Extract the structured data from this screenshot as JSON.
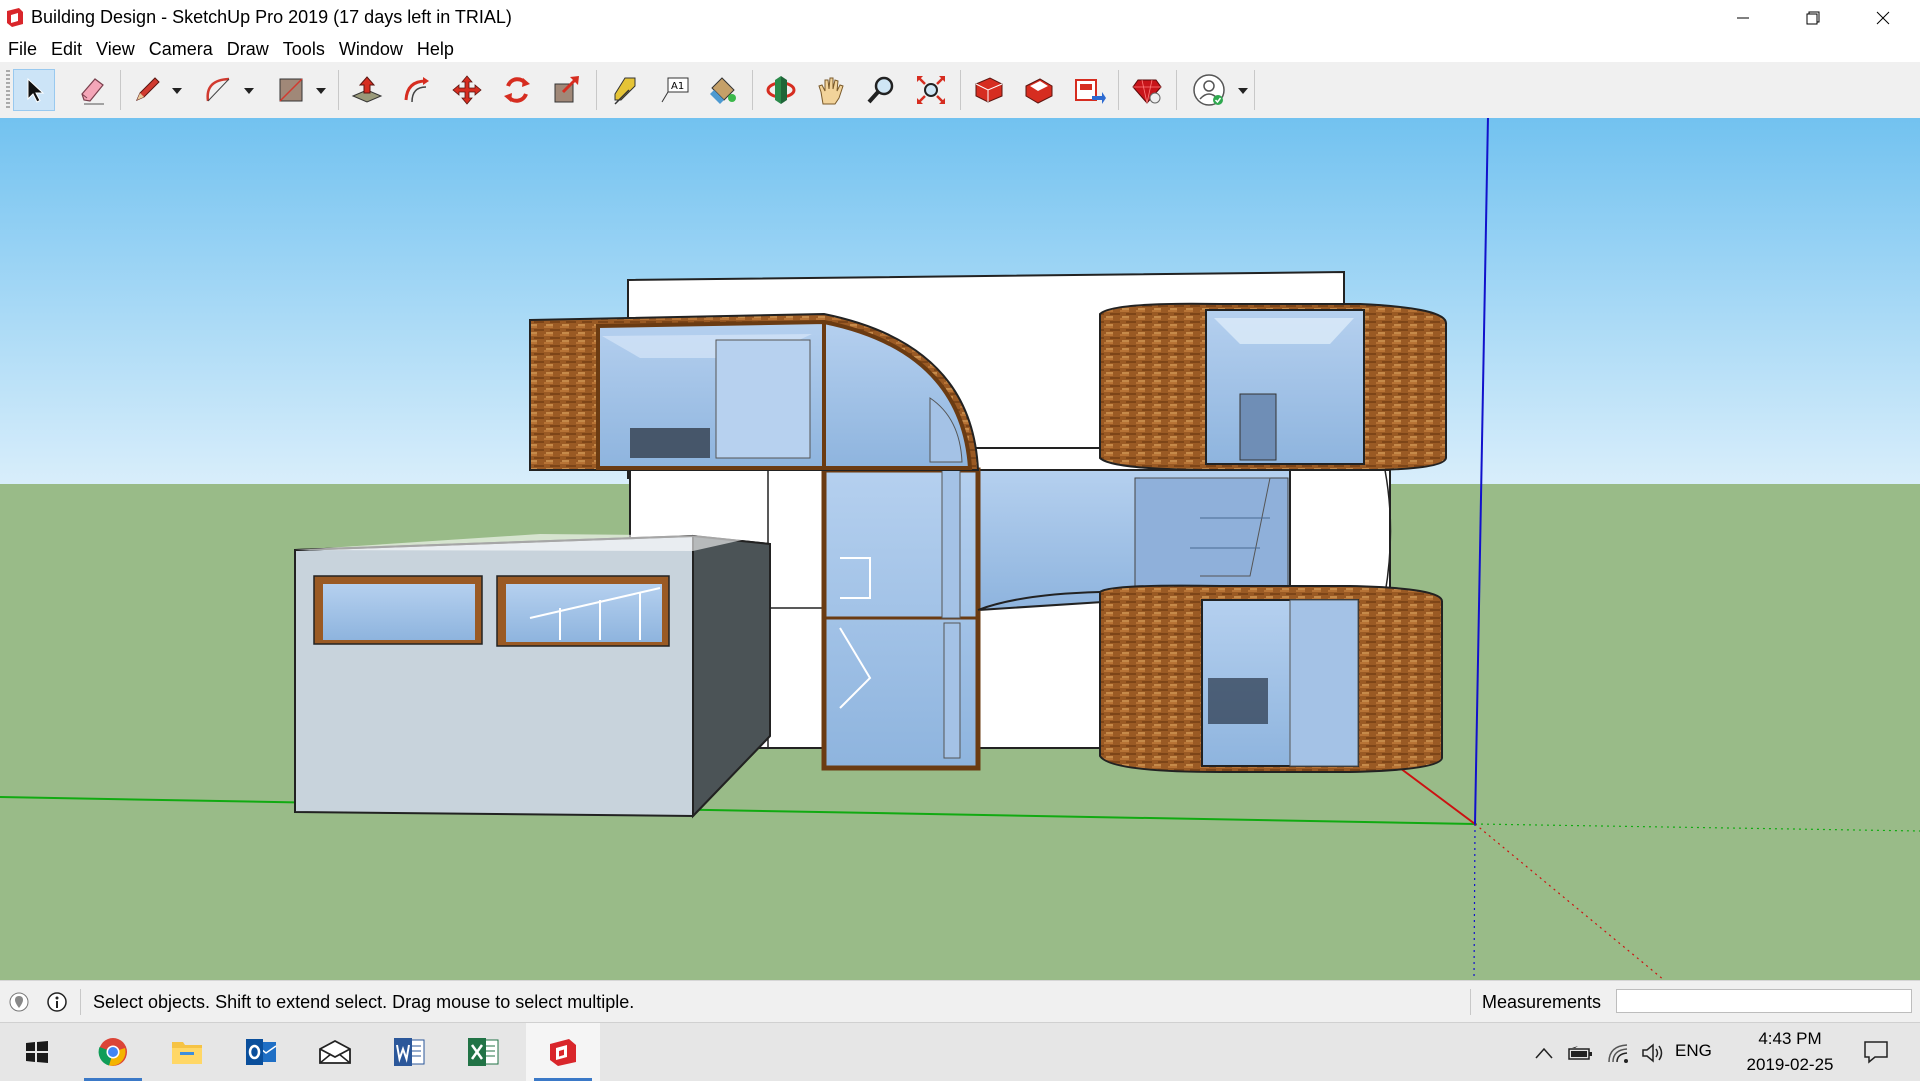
{
  "window": {
    "title": "Building Design - SketchUp Pro 2019 (17 days left in TRIAL)",
    "controls": [
      "minimize-icon",
      "restore-icon",
      "close-icon"
    ]
  },
  "menu": {
    "items": [
      "File",
      "Edit",
      "View",
      "Camera",
      "Draw",
      "Tools",
      "Window",
      "Help"
    ]
  },
  "toolbar": {
    "tools": [
      {
        "name": "select",
        "icon": "arrow-cursor-icon",
        "active": true
      },
      {
        "name": "eraser",
        "icon": "eraser-icon"
      },
      {
        "name": "line",
        "icon": "pencil-icon",
        "dropdown": true
      },
      {
        "name": "arc",
        "icon": "arc-icon",
        "dropdown": true
      },
      {
        "name": "rectangle",
        "icon": "rectangle-icon",
        "dropdown": true
      },
      {
        "name": "push-pull",
        "icon": "push-pull-icon"
      },
      {
        "name": "offset",
        "icon": "offset-icon"
      },
      {
        "name": "move",
        "icon": "move-icon"
      },
      {
        "name": "rotate",
        "icon": "rotate-icon"
      },
      {
        "name": "scale",
        "icon": "scale-icon"
      },
      {
        "name": "tape-measure",
        "icon": "tape-measure-icon"
      },
      {
        "name": "text",
        "icon": "text-icon",
        "glyph": "A1"
      },
      {
        "name": "paint-bucket",
        "icon": "paint-bucket-icon"
      },
      {
        "name": "orbit",
        "icon": "orbit-icon"
      },
      {
        "name": "pan",
        "icon": "hand-icon"
      },
      {
        "name": "zoom",
        "icon": "magnifier-icon"
      },
      {
        "name": "zoom-extents",
        "icon": "zoom-extents-icon"
      },
      {
        "name": "3d-warehouse",
        "icon": "warehouse-icon"
      },
      {
        "name": "extension-warehouse",
        "icon": "extension-warehouse-icon"
      },
      {
        "name": "send-to-layout",
        "icon": "layout-icon"
      },
      {
        "name": "extension-manager",
        "icon": "ruby-icon"
      },
      {
        "name": "account",
        "icon": "user-icon",
        "dropdown": true
      }
    ]
  },
  "status": {
    "message": "Select objects. Shift to extend select. Drag mouse to select multiple.",
    "measurements_label": "Measurements",
    "measurements_value": ""
  },
  "taskbar": {
    "apps": [
      {
        "name": "start",
        "icon": "windows-icon"
      },
      {
        "name": "chrome",
        "icon": "chrome-icon",
        "open": true
      },
      {
        "name": "file-explorer",
        "icon": "folder-icon"
      },
      {
        "name": "outlook",
        "icon": "outlook-icon"
      },
      {
        "name": "mail",
        "icon": "mail-icon"
      },
      {
        "name": "word",
        "icon": "word-icon"
      },
      {
        "name": "excel",
        "icon": "excel-icon"
      },
      {
        "name": "sketchup",
        "icon": "sketchup-icon",
        "open": true,
        "active": true
      }
    ],
    "tray": {
      "language": "ENG",
      "time": "4:43 PM",
      "date": "2019-02-25"
    }
  },
  "colors": {
    "sky_top": "#72c2f0",
    "sky_bottom": "#d9eefb",
    "ground": "#99bb88",
    "axis_red": "#cc1111",
    "axis_green": "#11aa11",
    "axis_blue": "#1111cc",
    "wood": "#9a5a24",
    "glass": "#8eb4de",
    "accent": "#3b79c7"
  }
}
